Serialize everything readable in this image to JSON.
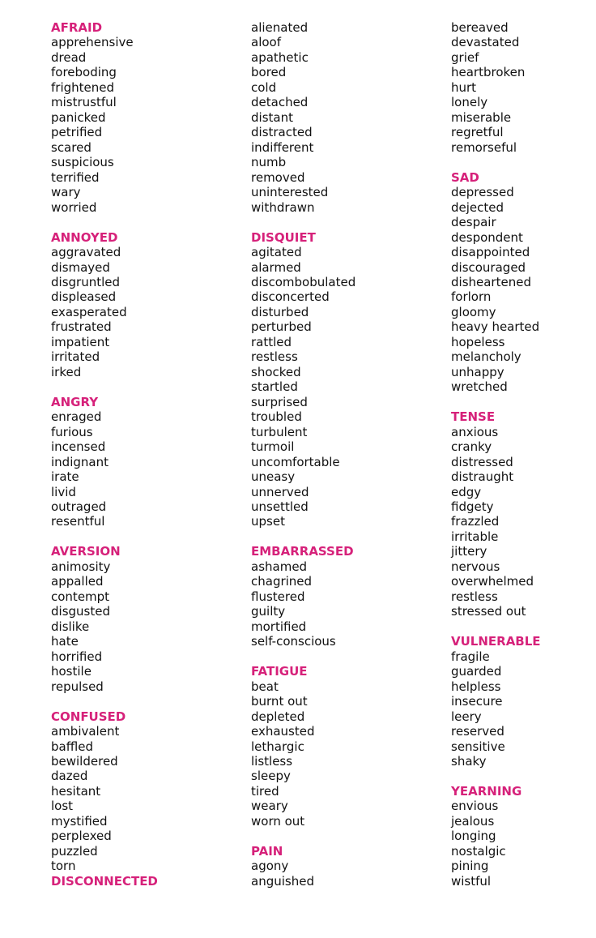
{
  "accent_color": "#d6217a",
  "columns": [
    [
      {
        "heading": "AFRAID",
        "words": [
          "apprehensive",
          "dread",
          "foreboding",
          "frightened",
          "mistrustful",
          "panicked",
          "petrified",
          "scared",
          "suspicious",
          "terrified",
          "wary",
          "worried"
        ]
      },
      {
        "heading": "ANNOYED",
        "words": [
          "aggravated",
          "dismayed",
          "disgruntled",
          "displeased",
          "exasperated",
          "frustrated",
          "impatient",
          "irritated",
          "irked"
        ]
      },
      {
        "heading": "ANGRY",
        "words": [
          "enraged",
          "furious",
          "incensed",
          "indignant",
          "irate",
          "livid",
          "outraged",
          "resentful"
        ]
      },
      {
        "heading": "AVERSION",
        "words": [
          "animosity",
          "appalled",
          "contempt",
          "disgusted",
          "dislike",
          "hate",
          "horrified",
          "hostile",
          "repulsed"
        ]
      },
      {
        "heading": "CONFUSED",
        "words": [
          "ambivalent",
          "baffled",
          "bewildered",
          "dazed",
          "hesitant",
          "lost",
          "mystified",
          "perplexed",
          "puzzled",
          "torn"
        ]
      },
      {
        "heading": "DISCONNECTED",
        "words": []
      }
    ],
    [
      {
        "heading": "",
        "words": [
          "alienated",
          "aloof",
          "apathetic",
          "bored",
          "cold",
          "detached",
          "distant",
          "distracted",
          "indifferent",
          "numb",
          "removed",
          "uninterested",
          "withdrawn"
        ]
      },
      {
        "heading": "DISQUIET",
        "words": [
          "agitated",
          "alarmed",
          "discombobulated",
          "disconcerted",
          "disturbed",
          "perturbed",
          "rattled",
          "restless",
          "shocked",
          "startled",
          "surprised",
          "troubled",
          "turbulent",
          "turmoil",
          "uncomfortable",
          "uneasy",
          "unnerved",
          "unsettled",
          "upset"
        ]
      },
      {
        "heading": "EMBARRASSED",
        "words": [
          "ashamed",
          "chagrined",
          "flustered",
          "guilty",
          "mortified",
          "self-conscious"
        ]
      },
      {
        "heading": "FATIGUE",
        "words": [
          "beat",
          "burnt out",
          "depleted",
          "exhausted",
          "lethargic",
          "listless",
          "sleepy",
          "tired",
          "weary",
          "worn out"
        ]
      },
      {
        "heading": "PAIN",
        "words": [
          "agony",
          "anguished"
        ]
      }
    ],
    [
      {
        "heading": "",
        "words": [
          "bereaved",
          "devastated",
          "grief",
          "heartbroken",
          "hurt",
          "lonely",
          "miserable",
          "regretful",
          "remorseful"
        ]
      },
      {
        "heading": "SAD",
        "words": [
          "depressed",
          "dejected",
          "despair",
          "despondent",
          "disappointed",
          "discouraged",
          "disheartened",
          "forlorn",
          "gloomy",
          "heavy hearted",
          "hopeless",
          "melancholy",
          "unhappy",
          "wretched"
        ]
      },
      {
        "heading": "TENSE",
        "words": [
          "anxious",
          "cranky",
          "distressed",
          "distraught",
          "edgy",
          "fidgety",
          "frazzled",
          "irritable",
          "jittery",
          "nervous",
          "overwhelmed",
          "restless",
          "stressed out"
        ]
      },
      {
        "heading": "VULNERABLE",
        "words": [
          "fragile",
          "guarded",
          "helpless",
          "insecure",
          "leery",
          "reserved",
          "sensitive",
          "shaky"
        ]
      },
      {
        "heading": "YEARNING",
        "words": [
          "envious",
          "jealous",
          "longing",
          "nostalgic",
          "pining",
          "wistful"
        ]
      }
    ]
  ]
}
